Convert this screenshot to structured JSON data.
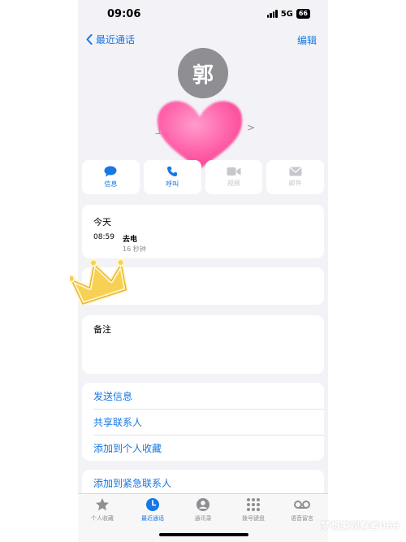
{
  "status_bar": {
    "time": "09:06",
    "network": "5G",
    "battery": "66"
  },
  "nav": {
    "back_label": "最近通话",
    "edit_label": "编辑"
  },
  "contact": {
    "avatar_text": "郭",
    "subtitle_fragment": "上",
    "subtitle_chevron": ">"
  },
  "actions": [
    {
      "label": "信息",
      "icon": "message-icon",
      "enabled": true
    },
    {
      "label": "呼叫",
      "icon": "phone-icon",
      "enabled": true
    },
    {
      "label": "视频",
      "icon": "video-icon",
      "enabled": false
    },
    {
      "label": "邮件",
      "icon": "mail-icon",
      "enabled": false
    }
  ],
  "recents": {
    "title": "今天",
    "call_time": "08:59",
    "call_type": "去电",
    "call_duration": "16 秒钟"
  },
  "notes": {
    "label": "备注"
  },
  "list_actions": [
    "发送信息",
    "共享联系人",
    "添加到个人收藏"
  ],
  "emergency": {
    "label": "添加到紧急联系人"
  },
  "tab_bar": [
    {
      "label": "个人收藏",
      "icon": "star-icon",
      "active": false
    },
    {
      "label": "最近通话",
      "icon": "clock-icon",
      "active": true
    },
    {
      "label": "通讯录",
      "icon": "contacts-icon",
      "active": false
    },
    {
      "label": "拨号键盘",
      "icon": "keypad-icon",
      "active": false
    },
    {
      "label": "语音留言",
      "icon": "voicemail-icon",
      "active": false
    }
  ],
  "watermark": "梦想家观察者066",
  "colors": {
    "accent": "#1677e5",
    "background": "#f2f2f7",
    "heart": "#ff5fa8",
    "crown": "#f7d154"
  }
}
